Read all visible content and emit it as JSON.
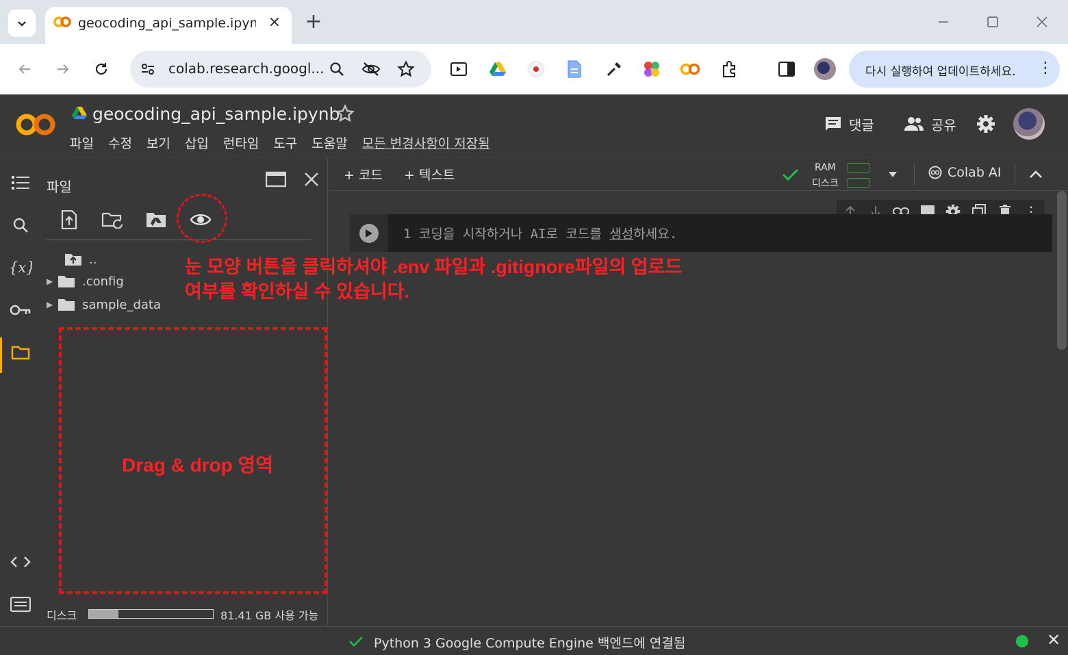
{
  "browser": {
    "tab_title": "geocoding_api_sample.ipynb -",
    "tab_close": "✕",
    "new_tab": "+",
    "url": "colab.research.googl...",
    "update_button": "다시 실행하여 업데이트하세요.",
    "update_menu": "⋮"
  },
  "colab": {
    "notebook_title": "geocoding_api_sample.ipynb",
    "menu": [
      "파일",
      "수정",
      "보기",
      "삽입",
      "런타임",
      "도구",
      "도움말"
    ],
    "saved_status": "모든 변경사항이 저장됨",
    "comment_label": "댓글",
    "share_label": "공유"
  },
  "file_panel": {
    "title": "파일",
    "tree": [
      {
        "name": "..",
        "type": "parent"
      },
      {
        "name": ".config",
        "type": "folder"
      },
      {
        "name": "sample_data",
        "type": "folder"
      }
    ],
    "disk_label": "디스크",
    "disk_free": "81.41 GB 사용 가능"
  },
  "main": {
    "add_code": "+ 코드",
    "add_text": "+ 텍스트",
    "ram_label": "RAM",
    "disk_label": "디스크",
    "colab_ai": "Colab AI",
    "cell_line_no": "1",
    "cell_placeholder_a": "코딩을 시작하거나 AI로 코드를 ",
    "cell_placeholder_link": "생성",
    "cell_placeholder_b": "하세요."
  },
  "annotations": {
    "eye_note_line1": "눈 모양 버튼을 클릭하셔야 .env 파일과 .gitignore파일의 업로드",
    "eye_note_line2": "여부를 확인하실 수 있습니다.",
    "drop_zone_label": "Drag & drop 영역",
    "color": "#ff1f24"
  },
  "status": {
    "text": "Python 3 Google Compute Engine 백엔드에 연결됨",
    "close": "✕"
  },
  "colors": {
    "colab_bg": "#383838",
    "accent_orange": "#f9ab00",
    "status_green": "#1ec04a"
  }
}
